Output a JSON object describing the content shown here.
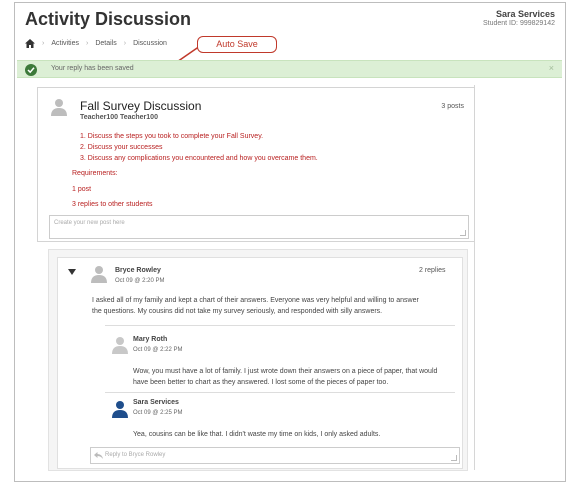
{
  "header": {
    "title": "Activity Discussion",
    "user_name": "Sara Services",
    "student_id": "Student ID: 999829142"
  },
  "breadcrumb": [
    "Activities",
    "Details",
    "Discussion"
  ],
  "callout": {
    "label": "Auto Save"
  },
  "alert": {
    "text": "Your reply has been saved"
  },
  "post": {
    "title": "Fall Survey Discussion",
    "author": "Teacher100 Teacher100",
    "count": "3 posts",
    "instructions": [
      "1. Discuss the steps you took to complete your Fall Survey.",
      "2. Discuss your successes",
      "3. Discuss any complications you encountered and how you overcame them."
    ],
    "requirements_label": "Requirements:",
    "req_posts": "1 post",
    "req_replies": "3 replies to other students",
    "new_post_placeholder": "Create your new post here"
  },
  "thread": {
    "author": "Bryce Rowley",
    "time": "Oct 09 @ 2:20 PM",
    "replies": "2 replies",
    "body": [
      "I asked all of my family and kept a chart of their answers. Everyone was very helpful and willing to answer",
      "the questions. My cousins did not take my survey seriously, and responded with silly answers."
    ],
    "reply1": {
      "author": "Mary Roth",
      "time": "Oct 09 @ 2:22 PM",
      "body": [
        "Wow, you must have a lot of family. I just wrote down their answers on a piece of paper, that would",
        "have been better to chart as they answered. I lost some of the pieces of paper too."
      ]
    },
    "reply2": {
      "author": "Sara Services",
      "time": "Oct 09 @ 2:25 PM",
      "body": "Yea, cousins can be like that. I didn't waste my time on kids, I only asked adults."
    },
    "reply_placeholder": "Reply to Bryce Rowley"
  },
  "colors": {
    "accent_red": "#b81f1f",
    "success_bg": "#dcefd5",
    "success_icon": "#3d7a3a",
    "self_avatar": "#1f4e8c"
  }
}
